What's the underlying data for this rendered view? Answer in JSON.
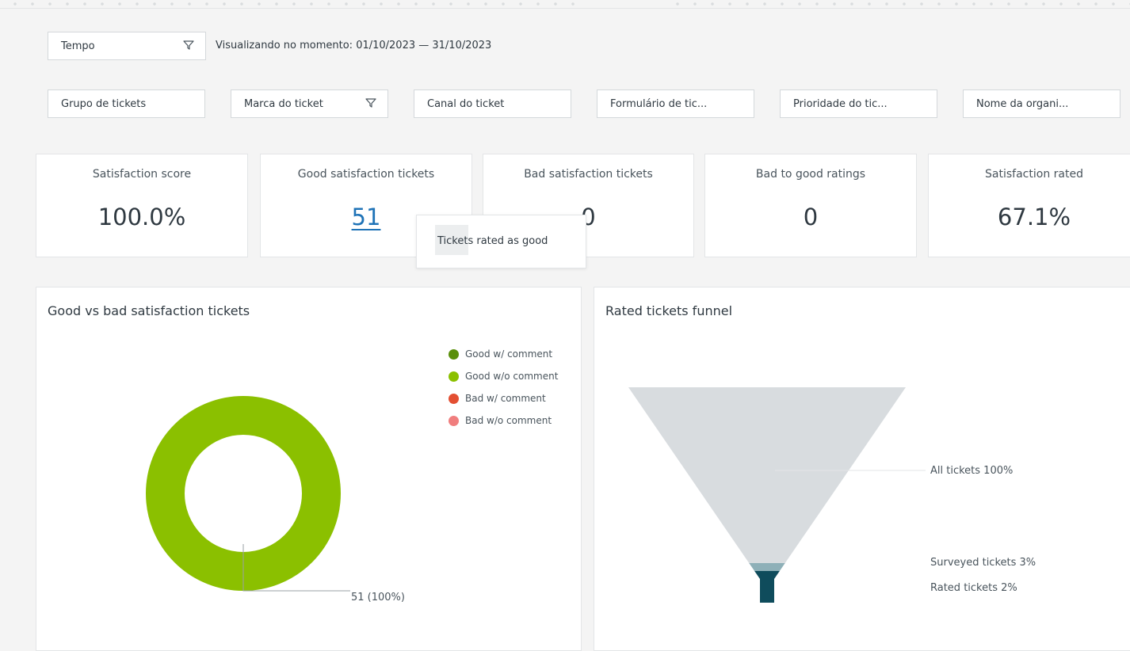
{
  "filters": {
    "time": {
      "label": "Tempo",
      "icon": "filter-icon"
    },
    "viewing_text": "Visualizando no momento: 01/10/2023 — 31/10/2023",
    "row": [
      {
        "label": "Grupo de tickets"
      },
      {
        "label": "Marca do ticket",
        "icon": "filter-icon"
      },
      {
        "label": "Canal do ticket"
      },
      {
        "label": "Formulário de tic..."
      },
      {
        "label": "Prioridade do tic..."
      },
      {
        "label": "Nome da organi..."
      }
    ]
  },
  "kpis": [
    {
      "label": "Satisfaction score",
      "value": "100.0%"
    },
    {
      "label": "Good satisfaction tickets",
      "value": "51"
    },
    {
      "label": "Bad satisfaction tickets",
      "value": "0"
    },
    {
      "label": "Bad to good ratings",
      "value": "0"
    },
    {
      "label": "Satisfaction rated",
      "value": "67.1%"
    }
  ],
  "tooltip": {
    "text": "Tickets rated as good"
  },
  "panels": {
    "donut": {
      "title": "Good vs bad satisfaction tickets",
      "legend": [
        {
          "label": "Good w/ comment",
          "color": "#5a8f0a"
        },
        {
          "label": "Good w/o comment",
          "color": "#8bc000"
        },
        {
          "label": "Bad w/ comment",
          "color": "#e34f32"
        },
        {
          "label": "Bad w/o comment",
          "color": "#f07e7e"
        }
      ]
    },
    "funnel": {
      "title": "Rated tickets funnel"
    }
  },
  "chart_data": [
    {
      "type": "pie",
      "variant": "donut",
      "title": "Good vs bad satisfaction tickets",
      "series": [
        {
          "name": "Good w/ comment",
          "value": 0
        },
        {
          "name": "Good w/o comment",
          "value": 51
        },
        {
          "name": "Bad w/ comment",
          "value": 0
        },
        {
          "name": "Bad w/o comment",
          "value": 0
        }
      ],
      "data_label": "51 (100%)",
      "colors": [
        "#5a8f0a",
        "#8bc000",
        "#e34f32",
        "#f07e7e"
      ],
      "legend_position": "top-right"
    },
    {
      "type": "funnel",
      "title": "Rated tickets funnel",
      "stages": [
        {
          "name": "All tickets",
          "label": "All tickets 100%",
          "value": 100,
          "color": "#d8dcdf"
        },
        {
          "name": "Surveyed tickets",
          "label": "Surveyed tickets 3%",
          "value": 3,
          "color": "#8eb0b8"
        },
        {
          "name": "Rated tickets",
          "label": "Rated tickets 2%",
          "value": 2,
          "color": "#0f4c5c"
        }
      ]
    }
  ]
}
